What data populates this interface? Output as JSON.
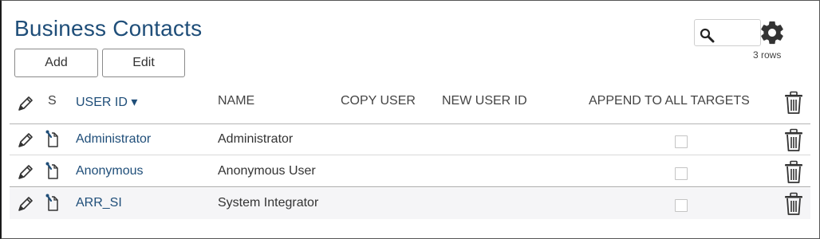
{
  "page": {
    "title": "Business Contacts"
  },
  "toolbar": {
    "add_label": "Add",
    "edit_label": "Edit"
  },
  "search": {
    "placeholder": "",
    "value": ""
  },
  "settings": {
    "row_count": "3 rows"
  },
  "table": {
    "columns": {
      "s": "S",
      "user_id": "USER ID ▾",
      "name": "NAME",
      "copy_user": "COPY USER",
      "new_user_id": "NEW USER ID",
      "append": "APPEND TO ALL TARGETS"
    },
    "rows": [
      {
        "user_id": "Administrator",
        "name": "Administrator",
        "copy_user": "",
        "new_user_id": "",
        "append_checked": false
      },
      {
        "user_id": "Anonymous",
        "name": "Anonymous User",
        "copy_user": "",
        "new_user_id": "",
        "append_checked": false
      },
      {
        "user_id": "ARR_SI",
        "name": "System Integrator",
        "copy_user": "",
        "new_user_id": "",
        "append_checked": false
      }
    ]
  },
  "icons": {
    "header_edit": "pencil-icon",
    "header_delete": "trash-icon",
    "row_edit": "pencil-icon",
    "row_status": "pinned-document-icon",
    "row_delete": "trash-icon",
    "search": "search-icon",
    "settings": "gear-icon"
  },
  "colors": {
    "title": "#1f4e79",
    "link": "#1f4e79",
    "highlight_row": "#f5f5f7"
  }
}
